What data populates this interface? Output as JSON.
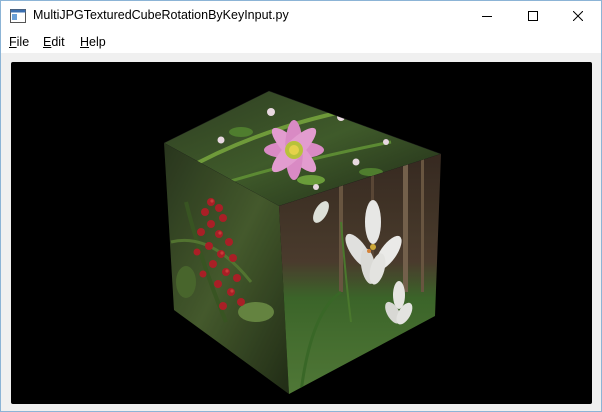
{
  "window": {
    "title": "MultiJPGTexturedCubeRotationByKeyInput.py",
    "controls": [
      "minimize",
      "maximize",
      "close"
    ]
  },
  "menubar": {
    "items": [
      {
        "label_first": "F",
        "label_rest": "ile"
      },
      {
        "label_first": "E",
        "label_rest": "dit"
      },
      {
        "label_first": "H",
        "label_rest": "elp"
      }
    ]
  },
  "viewport": {
    "background": "#000000",
    "content": "textured-cube",
    "faces": {
      "top": "pink-anemone-flower",
      "left": "red-berries",
      "right": "white-lily"
    }
  },
  "colors": {
    "titlebar_bg": "#ffffff",
    "window_bg": "#f0f0f0",
    "border": "#8cb4d6"
  }
}
